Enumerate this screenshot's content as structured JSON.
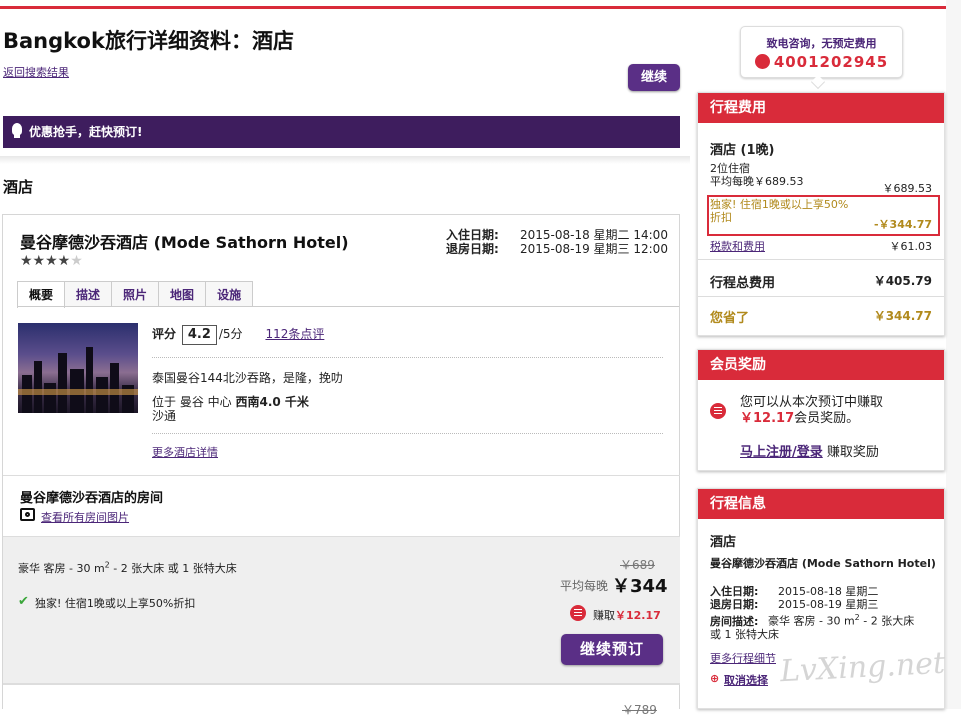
{
  "header": {
    "title": "Bangkok旅行详细资料：酒店",
    "back_link": "返回搜索结果",
    "continue_button": "继续"
  },
  "promo": {
    "text": "优惠抢手，赶快预订!"
  },
  "section": {
    "title": "酒店"
  },
  "hotel": {
    "name": "曼谷摩德沙吞酒店 (Mode Sathorn Hotel)",
    "stars": "★★★★★",
    "rating_value": 4,
    "checkin_label": "入住日期:",
    "checkin_value": "2015-08-18 星期二 14:00",
    "checkout_label": "退房日期:",
    "checkout_value": "2015-08-19 星期三 12:00",
    "tabs": [
      "概要",
      "描述",
      "照片",
      "地图",
      "设施"
    ],
    "score_label": "评分",
    "score": "4.2",
    "score_max": "/5分",
    "reviews": "112条点评",
    "address": "泰国曼谷144北沙吞路，是隆，挽叻",
    "location_prefix": "位于 曼谷 中心",
    "location_bold": "西南4.0 千米",
    "location_suffix": "沙通",
    "more_link": "更多酒店详情"
  },
  "rooms": {
    "title": "曼谷摩德沙吞酒店的房间",
    "photos_link": "查看所有房间图片",
    "room_desc_a": "豪华 客房 - 30 m",
    "room_desc_sup": "2",
    "room_desc_b": " - 2 张大床 或 1 张特大床",
    "exclusive": "独家! 住宿1晚或以上享50%折扣",
    "old_price": "￥689",
    "avg_label": "平均每晚",
    "new_price": "￥344",
    "earn_label": "赚取",
    "earn_value": "￥12.17",
    "book_button": "继续预订",
    "next_old_price": "￥789"
  },
  "call": {
    "title": "致电咨询，无预定费用",
    "phone": "4001202945"
  },
  "trip_cost": {
    "header": "行程费用",
    "hotel_label": "酒店 (1晚)",
    "guests": "2位住宿",
    "avg_line": "平均每晚￥689.53",
    "avg_amount": "￥689.53",
    "exclusive_line1": "独家! 住宿1晚或以上享50%",
    "exclusive_line2": "折扣",
    "exclusive_amount": "-￥344.77",
    "tax_link": "税款和费用",
    "tax_amount": "￥61.03",
    "total_label": "行程总费用",
    "total_amount": "￥405.79",
    "saved_label": "您省了",
    "saved_amount": "￥344.77"
  },
  "rewards": {
    "header": "会员奖励",
    "line1": "您可以从本次预订中赚取",
    "amount": "￥12.17",
    "line2": "会员奖励。",
    "register_link": "马上注册/登录",
    "register_suffix": " 赚取奖励"
  },
  "trip_info": {
    "header": "行程信息",
    "section": "酒店",
    "hotel_name": "曼谷摩德沙吞酒店 (Mode Sathorn Hotel)",
    "checkin_label": "入住日期:",
    "checkin_value": "2015-08-18 星期二",
    "checkout_label": "退房日期:",
    "checkout_value": "2015-08-19 星期三",
    "room_label": "房间描述:",
    "room_value_a": "豪华 客房 - 30 m",
    "room_sup": "2",
    "room_value_b": " - 2 张大床",
    "room_value_c": "或 1 张特大床",
    "more_link": "更多行程细节",
    "cancel_link": "取消选择"
  },
  "watermark": "LvXing.net",
  "colors": {
    "accent": "#d92b3a",
    "purple": "#4b2678",
    "promo_bg": "#3e1d5e",
    "gold": "#b18a1d"
  }
}
